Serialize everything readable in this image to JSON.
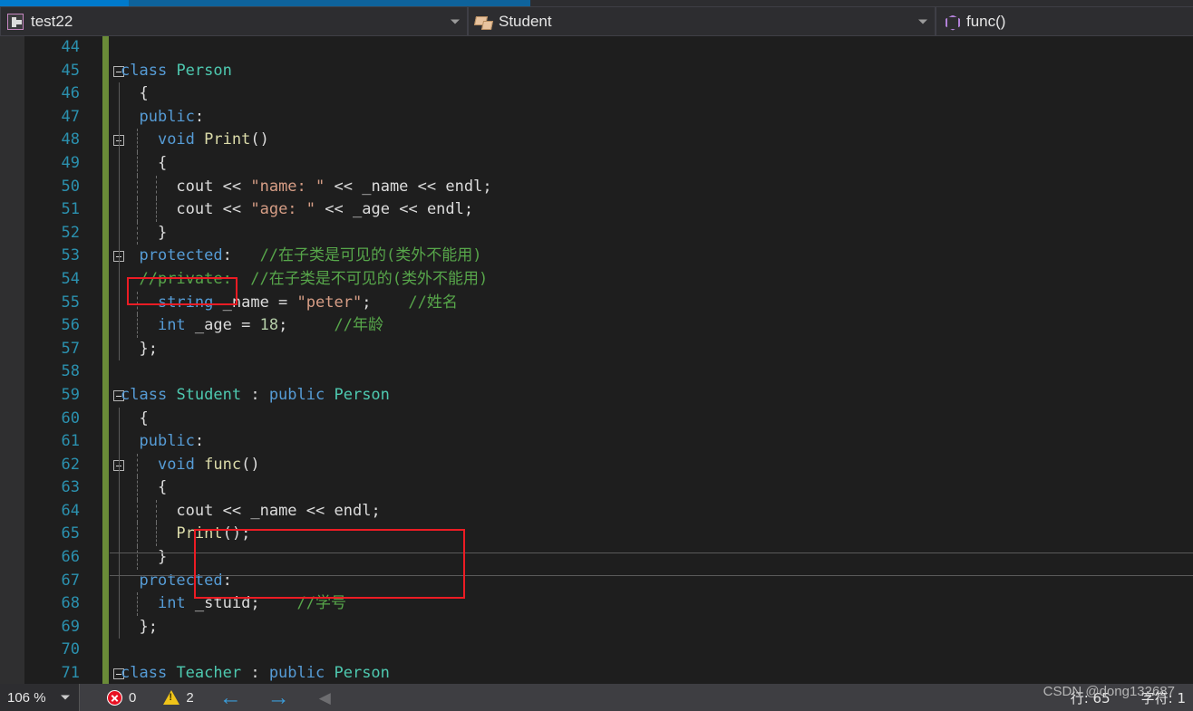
{
  "window": {
    "tabstrip": {
      "active_tab_color": "#007acc",
      "inactive_tab_color": "#0e639c"
    }
  },
  "navbar": {
    "project": {
      "icon": "project-icon",
      "label": "test22"
    },
    "class": {
      "icon": "class-icon",
      "label": "Student"
    },
    "member": {
      "icon": "method-icon",
      "label": "func()"
    }
  },
  "editor": {
    "language": "C++",
    "first_line": 44,
    "lines": [
      {
        "no": "44",
        "changed": true,
        "fold": null,
        "code": ""
      },
      {
        "no": "45",
        "changed": true,
        "fold": "open",
        "code": "class Person",
        "tokens": [
          [
            "kw",
            "class"
          ],
          [
            "pl",
            " "
          ],
          [
            "type",
            "Person"
          ]
        ]
      },
      {
        "no": "46",
        "changed": true,
        "fold": null,
        "code": "{",
        "indent": 1
      },
      {
        "no": "47",
        "changed": true,
        "fold": null,
        "code": "public:",
        "tokens": [
          [
            "kw",
            "public"
          ],
          [
            "pl",
            ":"
          ]
        ],
        "indent": 1
      },
      {
        "no": "48",
        "changed": true,
        "fold": "open",
        "code": "void Print()",
        "tokens": [
          [
            "kw",
            "void"
          ],
          [
            "pl",
            " "
          ],
          [
            "fn",
            "Print"
          ],
          [
            "pl",
            "()"
          ]
        ],
        "indent": 2
      },
      {
        "no": "49",
        "changed": true,
        "fold": null,
        "code": "{",
        "indent": 2
      },
      {
        "no": "50",
        "changed": true,
        "fold": null,
        "code": "cout << \"name: \" << _name << endl;",
        "indent": 3
      },
      {
        "no": "51",
        "changed": true,
        "fold": null,
        "code": "cout << \"age: \" << _age << endl;",
        "indent": 3
      },
      {
        "no": "52",
        "changed": true,
        "fold": null,
        "code": "}",
        "indent": 2
      },
      {
        "no": "53",
        "changed": true,
        "fold": "open",
        "code": "protected:   //在子类是可见的(类外不能用)",
        "indent": 1
      },
      {
        "no": "54",
        "changed": true,
        "fold": null,
        "code": "//private:  //在子类是不可见的(类外不能用)",
        "indent": 1
      },
      {
        "no": "55",
        "changed": true,
        "fold": null,
        "code": "string _name = \"peter\";    //姓名",
        "indent": 2
      },
      {
        "no": "56",
        "changed": true,
        "fold": null,
        "code": "int _age = 18;     //年龄",
        "indent": 2
      },
      {
        "no": "57",
        "changed": true,
        "fold": null,
        "code": "};",
        "indent": 1
      },
      {
        "no": "58",
        "changed": true,
        "fold": null,
        "code": ""
      },
      {
        "no": "59",
        "changed": true,
        "fold": "open",
        "code": "class Student : public Person"
      },
      {
        "no": "60",
        "changed": true,
        "fold": null,
        "code": "{",
        "indent": 1
      },
      {
        "no": "61",
        "changed": true,
        "fold": null,
        "code": "public:",
        "indent": 1
      },
      {
        "no": "62",
        "changed": true,
        "fold": "open",
        "code": "void func()",
        "indent": 2
      },
      {
        "no": "63",
        "changed": true,
        "fold": null,
        "code": "{",
        "indent": 2
      },
      {
        "no": "64",
        "changed": true,
        "fold": null,
        "code": "cout << _name << endl;",
        "indent": 3
      },
      {
        "no": "65",
        "changed": true,
        "fold": null,
        "code": "Print();",
        "indent": 3,
        "current": true
      },
      {
        "no": "66",
        "changed": true,
        "fold": null,
        "code": "}",
        "indent": 2
      },
      {
        "no": "67",
        "changed": true,
        "fold": null,
        "code": "protected:",
        "indent": 1
      },
      {
        "no": "68",
        "changed": true,
        "fold": null,
        "code": "int _stuid;    //学号",
        "indent": 2
      },
      {
        "no": "69",
        "changed": true,
        "fold": null,
        "code": "};",
        "indent": 1
      },
      {
        "no": "70",
        "changed": true,
        "fold": null,
        "code": ""
      },
      {
        "no": "71",
        "changed": true,
        "fold": "open",
        "code": "class Teacher : public Person"
      }
    ],
    "annotations": [
      {
        "name": "protected-highlight",
        "color": "#ec1c24"
      },
      {
        "name": "func-body-highlight",
        "color": "#ec1c24"
      }
    ]
  },
  "statusbar": {
    "zoom": "106 %",
    "errors": {
      "icon": "error-icon",
      "count": "0"
    },
    "warnings": {
      "icon": "warning-icon",
      "count": "2"
    },
    "nav_back": "←",
    "nav_forward": "→",
    "nav_collapse": "◀",
    "line_label": "行: 65",
    "char_label": "字符: 1",
    "watermark": "CSDN @dong132687"
  }
}
